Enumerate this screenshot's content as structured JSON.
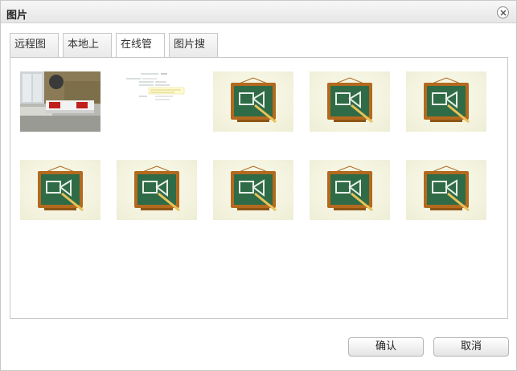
{
  "dialog": {
    "title": "图片",
    "close_icon": "close-icon"
  },
  "tabs": [
    {
      "label": "远程图片",
      "active": false
    },
    {
      "label": "本地上传",
      "active": false
    },
    {
      "label": "在线管理",
      "active": true
    },
    {
      "label": "图片搜索",
      "active": false
    }
  ],
  "images": [
    {
      "kind": "photo",
      "subject": "bedroom-photo"
    },
    {
      "kind": "form-screenshot",
      "subject": "form-screenshot"
    },
    {
      "kind": "placeholder",
      "subject": "chalkboard-image-icon"
    },
    {
      "kind": "placeholder",
      "subject": "chalkboard-image-icon"
    },
    {
      "kind": "placeholder",
      "subject": "chalkboard-image-icon"
    },
    {
      "kind": "placeholder",
      "subject": "chalkboard-image-icon"
    },
    {
      "kind": "placeholder",
      "subject": "chalkboard-image-icon"
    },
    {
      "kind": "placeholder",
      "subject": "chalkboard-image-icon"
    },
    {
      "kind": "placeholder",
      "subject": "chalkboard-image-icon"
    },
    {
      "kind": "placeholder",
      "subject": "chalkboard-image-icon"
    }
  ],
  "buttons": {
    "confirm_label": "确认",
    "cancel_label": "取消"
  },
  "colors": {
    "chalkboard_green": "#2f6b46",
    "frame_wood": "#b36a1f"
  }
}
